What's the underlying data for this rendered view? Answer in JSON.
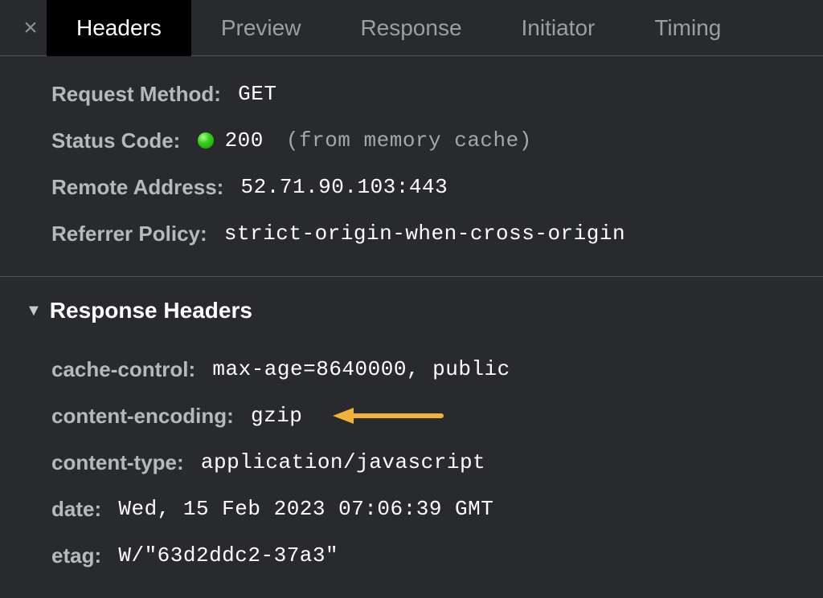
{
  "tabs": {
    "headers": "Headers",
    "preview": "Preview",
    "response": "Response",
    "initiator": "Initiator",
    "timing": "Timing"
  },
  "general": {
    "requestMethodLabel": "Request Method:",
    "requestMethodValue": "GET",
    "statusCodeLabel": "Status Code:",
    "statusCodeValue": "200",
    "statusCodeNote": "(from memory cache)",
    "remoteAddressLabel": "Remote Address:",
    "remoteAddressValue": "52.71.90.103:443",
    "referrerPolicyLabel": "Referrer Policy:",
    "referrerPolicyValue": "strict-origin-when-cross-origin"
  },
  "responseSection": {
    "title": "Response Headers",
    "cacheControlLabel": "cache-control:",
    "cacheControlValue": "max-age=8640000, public",
    "contentEncodingLabel": "content-encoding:",
    "contentEncodingValue": "gzip",
    "contentTypeLabel": "content-type:",
    "contentTypeValue": "application/javascript",
    "dateLabel": "date:",
    "dateValue": "Wed, 15 Feb 2023 07:06:39 GMT",
    "etagLabel": "etag:",
    "etagValue": "W/\"63d2ddc2-37a3\""
  },
  "annotation": {
    "arrowColor": "#f2b138"
  }
}
